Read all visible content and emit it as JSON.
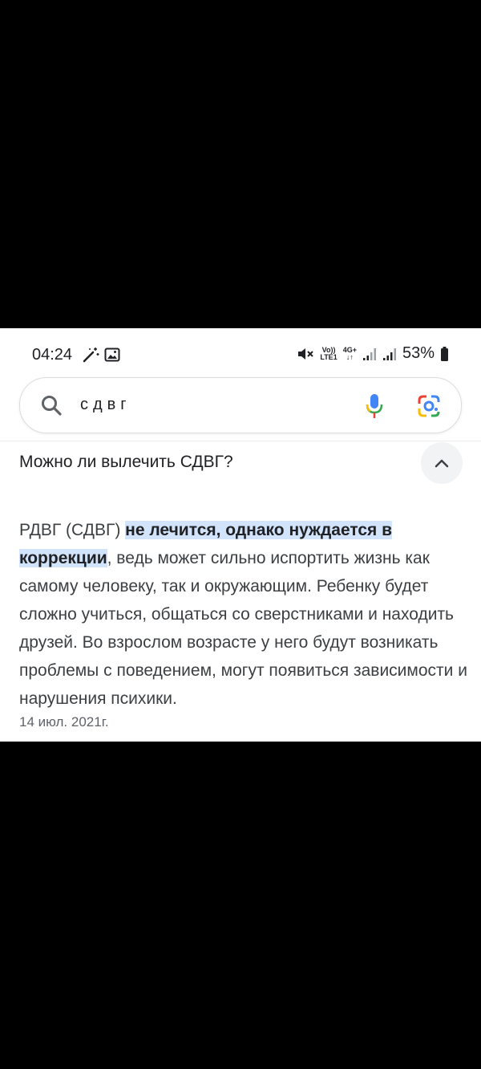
{
  "status_bar": {
    "time": "04:24",
    "battery": "53%",
    "network_top": "Vo)) 4G+",
    "network_bottom": "LTE1 ↓↑"
  },
  "search": {
    "query": "сдвг"
  },
  "result": {
    "question": "Можно ли вылечить СДВГ?",
    "answer_prefix": "РДВГ (СДВГ) ",
    "answer_highlight": "не лечится, однако нуждается в коррекции",
    "answer_rest": ", ведь может сильно испортить жизнь как самому человеку, так и окружающим. Ребенку будет сложно учиться, общаться со сверстниками и находить друзей. Во взрослом возрасте у него будут возникать проблемы с поведением, могут появиться зависимости и нарушения психики.",
    "date": "14 июл. 2021г."
  },
  "colors": {
    "highlight": "#d2e3fc",
    "google_blue": "#4285f4",
    "google_red": "#ea4335",
    "google_yellow": "#fbbc05",
    "google_green": "#34a853"
  }
}
